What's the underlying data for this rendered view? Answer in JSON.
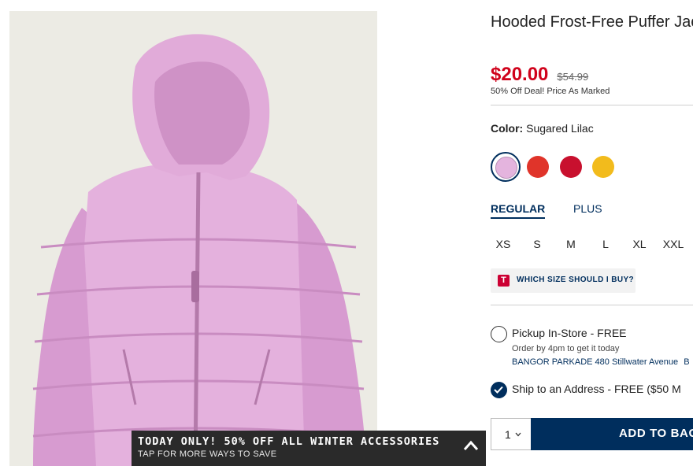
{
  "product": {
    "title": "Hooded Frost-Free Puffer Jacket for Girls",
    "sale_price": "$20.00",
    "original_price": "$54.99",
    "price_note": "50% Off Deal! Price As Marked",
    "image_icon": "puffer-jacket-image"
  },
  "color": {
    "label": "Color:",
    "value": "Sugared Lilac",
    "swatches": [
      {
        "name": "Sugared Lilac",
        "hex": "#e4b4de",
        "selected": true
      },
      {
        "name": "Red",
        "hex": "#e0342a",
        "selected": false
      },
      {
        "name": "Crimson",
        "hex": "#c8102e",
        "selected": false
      },
      {
        "name": "Yellow",
        "hex": "#f2bb1c",
        "selected": false
      }
    ]
  },
  "fit": {
    "tabs": [
      {
        "label": "REGULAR",
        "active": true
      },
      {
        "label": "PLUS",
        "active": false
      }
    ]
  },
  "sizes": [
    "XS",
    "S",
    "M",
    "L",
    "XL",
    "XXL"
  ],
  "size_guide": {
    "badge": "T",
    "label": "WHICH SIZE SHOULD I BUY?"
  },
  "shipping": {
    "pickup_label": "Pickup In-Store - FREE",
    "pickup_note": "Order by 4pm to get it today",
    "store": "BANGOR PARKADE 480 Stillwater Avenue",
    "store_suffix": "B",
    "ship_label": "Ship to an Address - FREE ($50 M",
    "selected": "ship"
  },
  "cart": {
    "quantity": "1",
    "add_label": "ADD TO BAG"
  },
  "promo": {
    "title": "TODAY ONLY! 50% OFF ALL WINTER ACCESSORIES",
    "subtitle": "TAP FOR MORE WAYS TO SAVE"
  },
  "colors": {
    "brand_navy": "#002e5d",
    "sale_red": "#d0021b",
    "banner_bg": "#2a2a2a"
  }
}
